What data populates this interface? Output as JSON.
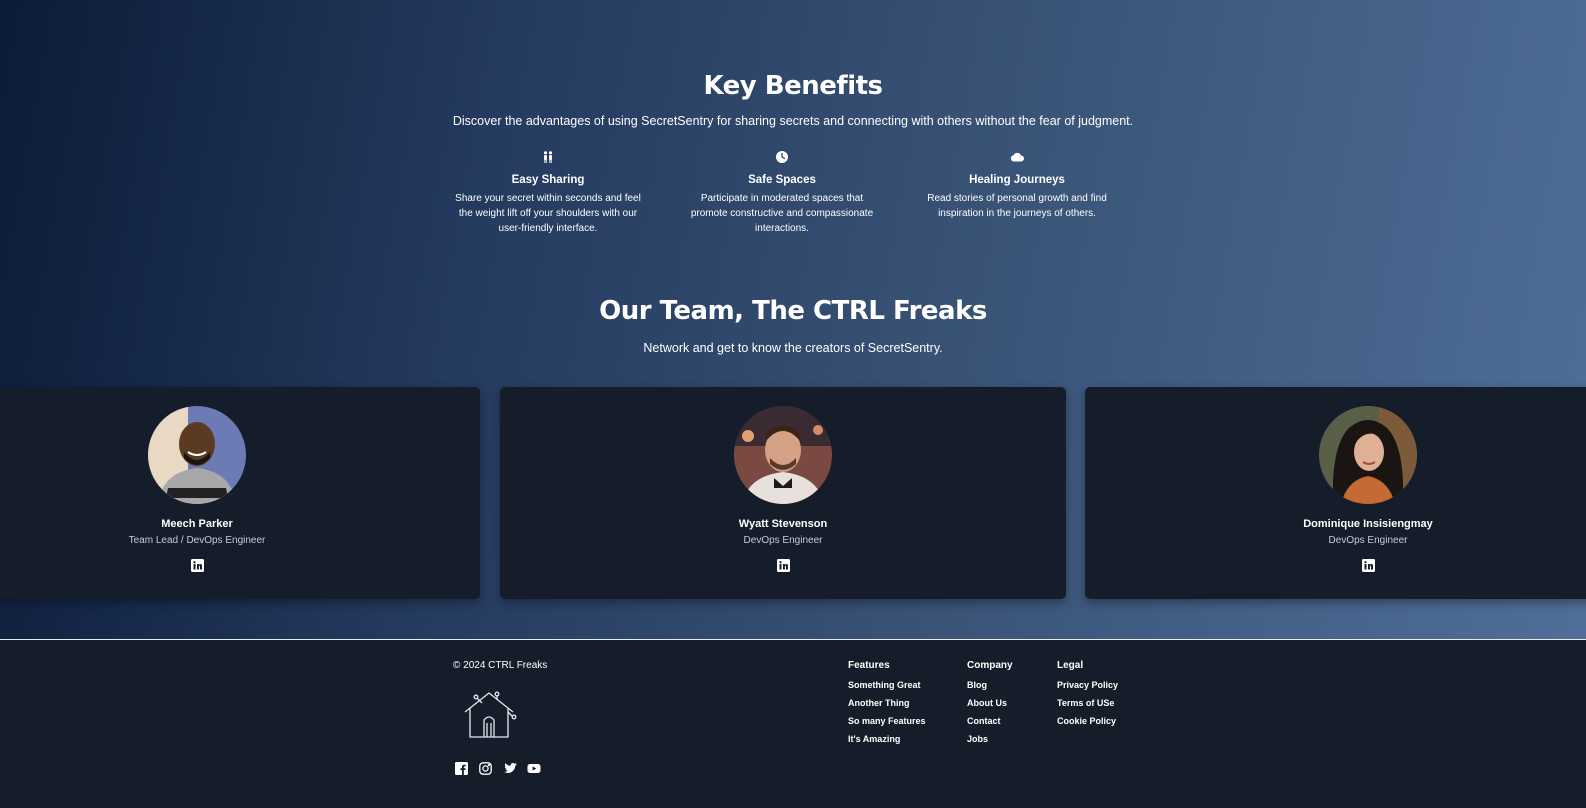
{
  "benefits": {
    "title": "Key Benefits",
    "subtitle": "Discover the advantages of using SecretSentry for sharing secrets and connecting with others without the fear of judgment.",
    "items": [
      {
        "icon": "people-icon",
        "title": "Easy Sharing",
        "description": "Share your secret within seconds and feel the weight lift off your shoulders with our user-friendly interface."
      },
      {
        "icon": "clock-icon",
        "title": "Safe Spaces",
        "description": "Participate in moderated spaces that promote constructive and compassionate interactions."
      },
      {
        "icon": "cloud-icon",
        "title": "Healing Journeys",
        "description": "Read stories of personal growth and find inspiration in the journeys of others."
      }
    ]
  },
  "team": {
    "title": "Our Team, The CTRL Freaks",
    "subtitle": "Network and get to know the creators of SecretSentry.",
    "members": [
      {
        "name": "Meech Parker",
        "role": "Team Lead / DevOps Engineer",
        "icon": "linkedin-icon"
      },
      {
        "name": "Wyatt Stevenson",
        "role": "DevOps Engineer",
        "icon": "linkedin-icon"
      },
      {
        "name": "Dominique Insisiengmay",
        "role": "DevOps Engineer",
        "icon": "linkedin-icon"
      }
    ]
  },
  "footer": {
    "copyright": "© 2024 CTRL Freaks",
    "socials": [
      "facebook-icon",
      "instagram-icon",
      "twitter-icon",
      "youtube-icon"
    ],
    "columns": [
      {
        "heading": "Features",
        "links": [
          "Something Great",
          "Another Thing",
          "So many Features",
          "It's Amazing"
        ]
      },
      {
        "heading": "Company",
        "links": [
          "Blog",
          "About Us",
          "Contact",
          "Jobs"
        ]
      },
      {
        "heading": "Legal",
        "links": [
          "Privacy Policy",
          "Terms of USe",
          "Cookie Policy"
        ]
      }
    ]
  },
  "colors": {
    "background_dark": "#161d2a",
    "gradient_start": "#0c1b38",
    "gradient_end": "#4f6f98",
    "text": "#ffffff"
  }
}
